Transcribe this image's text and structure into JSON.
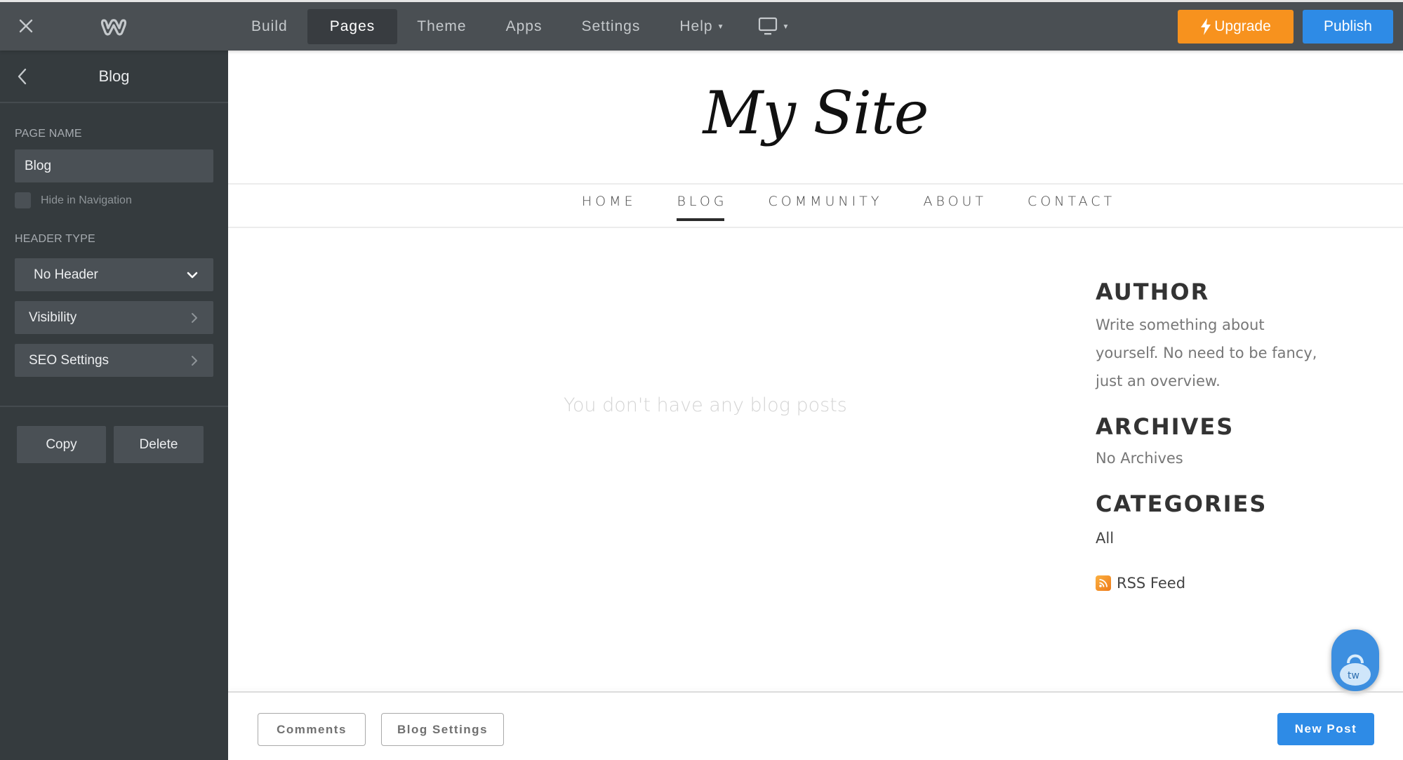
{
  "topbar": {
    "tabs": [
      {
        "label": "Build",
        "active": false
      },
      {
        "label": "Pages",
        "active": true
      },
      {
        "label": "Theme",
        "active": false
      },
      {
        "label": "Apps",
        "active": false
      },
      {
        "label": "Settings",
        "active": false
      },
      {
        "label": "Help",
        "active": false,
        "has_dropdown": true
      }
    ],
    "device_icon": "desktop-icon",
    "upgrade_label": "Upgrade",
    "publish_label": "Publish",
    "colors": {
      "upgrade": "#f7921e",
      "publish": "#2e8be6"
    }
  },
  "sidebar": {
    "title": "Blog",
    "page_name_label": "PAGE NAME",
    "page_name_value": "Blog",
    "hide_in_navigation_label": "Hide in Navigation",
    "hide_in_navigation_checked": false,
    "header_type_label": "HEADER TYPE",
    "header_type_value": "No Header",
    "visibility_label": "Visibility",
    "seo_settings_label": "SEO Settings",
    "copy_label": "Copy",
    "delete_label": "Delete"
  },
  "site": {
    "title": "My Site",
    "nav": [
      {
        "label": "HOME",
        "active": false
      },
      {
        "label": "BLOG",
        "active": true
      },
      {
        "label": "COMMUNITY",
        "active": false
      },
      {
        "label": "ABOUT",
        "active": false
      },
      {
        "label": "CONTACT",
        "active": false
      }
    ],
    "empty_message": "You don't have any blog posts",
    "widgets": {
      "author_title": "AUTHOR",
      "author_text": "Write something about yourself. No need to be fancy, just an overview.",
      "archives_title": "ARCHIVES",
      "archives_text": "No Archives",
      "categories_title": "CATEGORIES",
      "categories_all": "All",
      "rss_label": "RSS Feed"
    }
  },
  "footer": {
    "comments_label": "Comments",
    "blog_settings_label": "Blog Settings",
    "new_post_label": "New Post"
  }
}
